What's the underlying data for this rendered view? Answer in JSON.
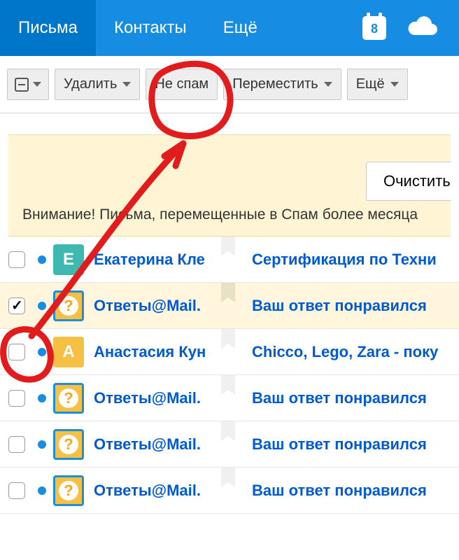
{
  "nav": {
    "tab_mail": "Письма",
    "tab_contacts": "Контакты",
    "tab_more": "Ещё",
    "calendar_day": "8"
  },
  "toolbar": {
    "delete": "Удалить",
    "not_spam": "Не спам",
    "move": "Переместить",
    "more": "Ещё"
  },
  "notice": {
    "clear_button": "Очистить па",
    "text": "Внимание! Письма, перемещенные в Спам более месяца"
  },
  "emails": [
    {
      "sender": "Екатерина Кле",
      "subject": "Сертификация по Техни",
      "avatar_letter": "Е",
      "avatar_class": "teal",
      "checked": false
    },
    {
      "sender": "Ответы@Mail.",
      "subject": "Ваш ответ понравился",
      "avatar_letter": "",
      "avatar_class": "q",
      "checked": true
    },
    {
      "sender": "Анастасия Кун",
      "subject": "Chicco, Lego, Zara - поку",
      "avatar_letter": "А",
      "avatar_class": "amber",
      "checked": false
    },
    {
      "sender": "Ответы@Mail.",
      "subject": "Ваш ответ понравился",
      "avatar_letter": "",
      "avatar_class": "q",
      "checked": false
    },
    {
      "sender": "Ответы@Mail.",
      "subject": "Ваш ответ понравился",
      "avatar_letter": "",
      "avatar_class": "q",
      "checked": false
    },
    {
      "sender": "Ответы@Mail.",
      "subject": "Ваш ответ понравился",
      "avatar_letter": "",
      "avatar_class": "q",
      "checked": false
    }
  ]
}
